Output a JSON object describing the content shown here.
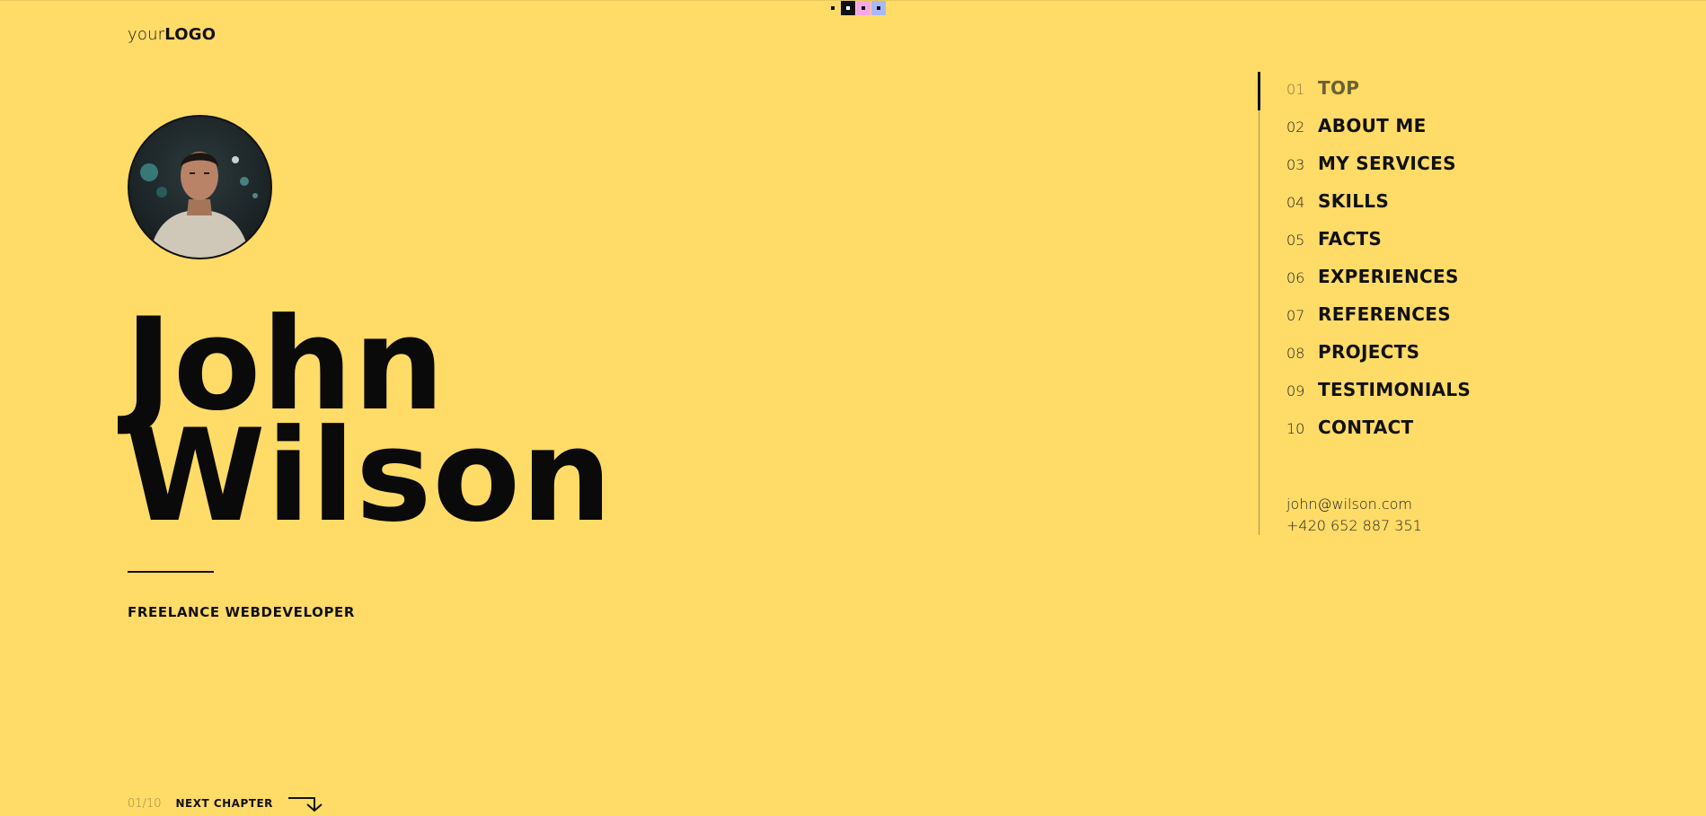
{
  "colors": {
    "background": "#FFDB67",
    "text": "#111111",
    "swatches": [
      "#FFDB67",
      "#111111",
      "#F7A8E6",
      "#A8B8FF"
    ]
  },
  "color_switcher": {
    "swatches": [
      {
        "name": "yellow-swatch",
        "color": "#FFDB67"
      },
      {
        "name": "black-swatch",
        "color": "#111111"
      },
      {
        "name": "pink-swatch",
        "color": "#F7A8E6"
      },
      {
        "name": "blue-swatch",
        "color": "#A8B8FF"
      }
    ]
  },
  "logo": {
    "light": "your",
    "bold": "LOGO"
  },
  "hero": {
    "avatar_icon": "person-photo",
    "first_name": "John",
    "last_name": "Wilson",
    "role": "FREELANCE WEBDEVELOPER"
  },
  "pager": {
    "count": "01/10",
    "next_label": "NEXT CHAPTER",
    "arrow_icon": "arrow-down-right-icon"
  },
  "nav": {
    "active_index": 0,
    "items": [
      {
        "num": "01",
        "label": "TOP"
      },
      {
        "num": "02",
        "label": "ABOUT ME"
      },
      {
        "num": "03",
        "label": "MY SERVICES"
      },
      {
        "num": "04",
        "label": "SKILLS"
      },
      {
        "num": "05",
        "label": "FACTS"
      },
      {
        "num": "06",
        "label": "EXPERIENCES"
      },
      {
        "num": "07",
        "label": "REFERENCES"
      },
      {
        "num": "08",
        "label": "PROJECTS"
      },
      {
        "num": "09",
        "label": "TESTIMONIALS"
      },
      {
        "num": "10",
        "label": "CONTACT"
      }
    ]
  },
  "contact": {
    "email": "john@wilson.com",
    "phone": "+420 652 887 351"
  }
}
